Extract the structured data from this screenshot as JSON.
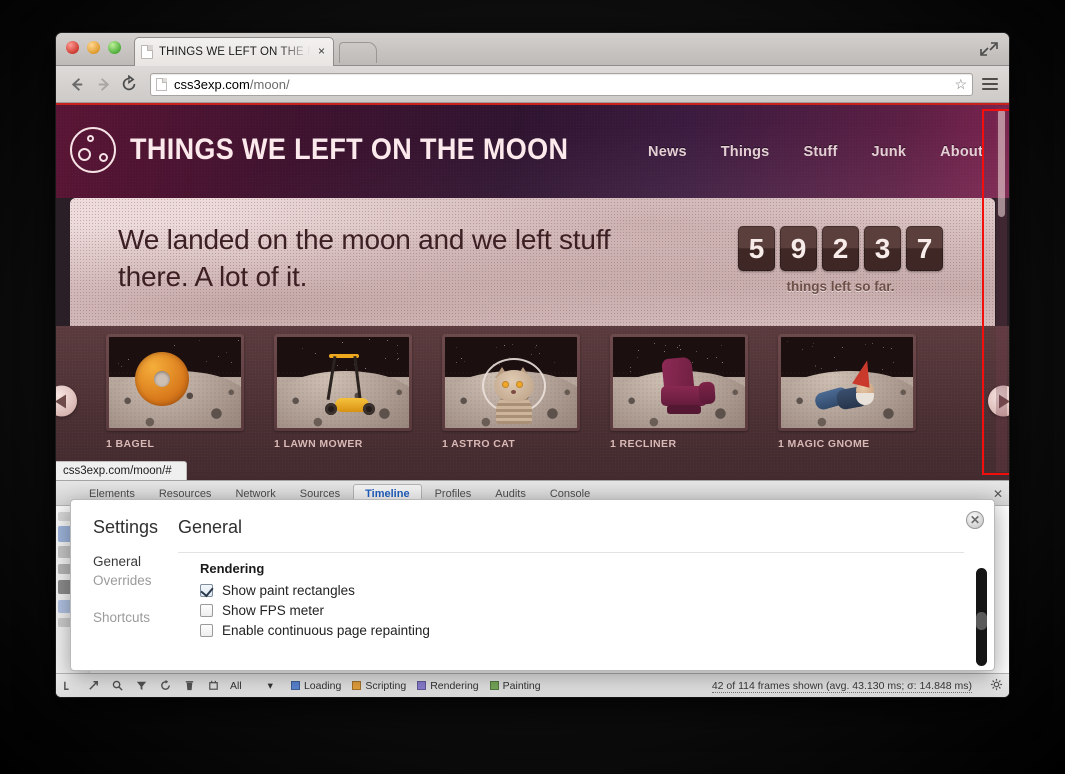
{
  "browser": {
    "window_controls": [
      "close",
      "minimize",
      "zoom"
    ],
    "tab": {
      "title": "THINGS WE LEFT ON THE M",
      "close_label": "×",
      "favicon": "page-icon"
    },
    "new_tab_label": "",
    "maximize_icon": "fullscreen-arrows-icon",
    "toolbar": {
      "back_icon": "arrow-left-icon",
      "forward_icon": "arrow-right-icon",
      "reload_icon": "reload-icon",
      "url_host": "css3exp.com",
      "url_path": "/moon/",
      "bookmark_icon": "star-icon",
      "menu_icon": "hamburger-menu-icon"
    },
    "status_bubble": "css3exp.com/moon/#"
  },
  "site": {
    "brand": {
      "logo": "moon-icon",
      "title": "THINGS WE LEFT ON THE MOON"
    },
    "nav": [
      {
        "label": "News"
      },
      {
        "label": "Things"
      },
      {
        "label": "Stuff"
      },
      {
        "label": "Junk"
      },
      {
        "label": "About"
      }
    ],
    "hero": {
      "headline": "We landed on the moon and we left stuff there. A lot of it.",
      "counter_digits": [
        "5",
        "9",
        "2",
        "3",
        "7"
      ],
      "counter_caption": "things left so far."
    },
    "carousel": {
      "prev_icon": "arrow-left-circle-icon",
      "next_icon": "arrow-right-circle-icon",
      "cards": [
        {
          "label": "1 BAGEL",
          "art": "donut"
        },
        {
          "label": "1 LAWN MOWER",
          "art": "mower"
        },
        {
          "label": "1 ASTRO CAT",
          "art": "cat"
        },
        {
          "label": "1 RECLINER",
          "art": "recliner"
        },
        {
          "label": "1 MAGIC GNOME",
          "art": "gnome"
        }
      ]
    },
    "paint_rect_color": "#f40d0d"
  },
  "devtools": {
    "tabs": [
      {
        "label": "Elements",
        "selected": false
      },
      {
        "label": "Resources",
        "selected": false
      },
      {
        "label": "Network",
        "selected": false
      },
      {
        "label": "Sources",
        "selected": false
      },
      {
        "label": "Timeline",
        "selected": true
      },
      {
        "label": "Profiles",
        "selected": false
      },
      {
        "label": "Audits",
        "selected": false
      },
      {
        "label": "Console",
        "selected": false
      }
    ],
    "close_icon": "close-icon",
    "status": {
      "record_icon": "record-icon",
      "clear_icon": "clear-icon",
      "glass_icon": "magnifier-icon",
      "filter_icon": "filter-icon",
      "refresh_icon": "refresh-icon",
      "trash_icon": "trash-icon",
      "memory_icon": "memory-icon",
      "filter_value": "All",
      "legend": [
        {
          "label": "Loading",
          "color": "#5b87d6"
        },
        {
          "label": "Scripting",
          "color": "#e8a33d"
        },
        {
          "label": "Rendering",
          "color": "#8a7fd4"
        },
        {
          "label": "Painting",
          "color": "#77ab5a"
        }
      ],
      "frames_text": "42 of 114 frames shown (avg. 43.130 ms; σ: 14.848 ms)",
      "gear_icon": "gear-icon"
    }
  },
  "settings": {
    "title": "Settings",
    "pane_title": "General",
    "close_label": "✕",
    "sidebar": [
      {
        "label": "General",
        "state": "active"
      },
      {
        "label": "Overrides",
        "state": "inactive"
      },
      {
        "label": "Shortcuts",
        "state": "spaced"
      }
    ],
    "group_title": "Rendering",
    "options": [
      {
        "label": "Show paint rectangles",
        "checked": true
      },
      {
        "label": "Show FPS meter",
        "checked": false
      },
      {
        "label": "Enable continuous page repainting",
        "checked": false
      }
    ]
  }
}
